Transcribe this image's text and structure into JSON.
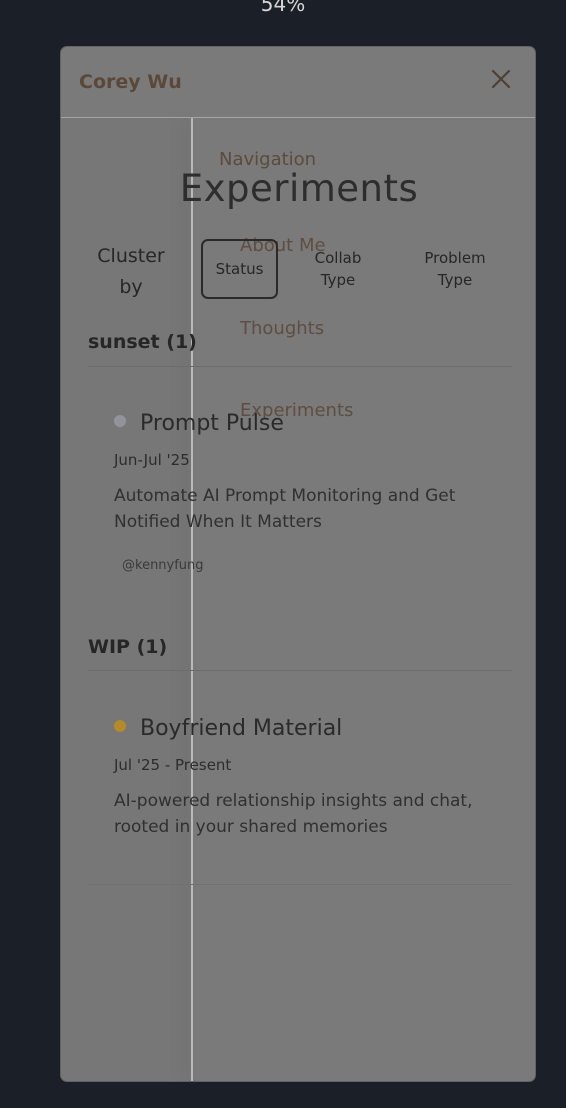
{
  "zoom": "54%",
  "header": {
    "brand": "Corey Wu",
    "close_icon": "close-icon"
  },
  "navigation": {
    "heading": "Navigation",
    "items": [
      "About Me",
      "Thoughts",
      "Experiments"
    ]
  },
  "page": {
    "title": "Experiments"
  },
  "cluster": {
    "label_line1": "Cluster",
    "label_line2": "by",
    "options": [
      {
        "line1": "Status",
        "line2": "",
        "selected": true
      },
      {
        "line1": "Collab",
        "line2": "Type",
        "selected": false
      },
      {
        "line1": "Problem",
        "line2": "Type",
        "selected": false
      }
    ]
  },
  "groups": [
    {
      "title": "sunset (1)",
      "items": [
        {
          "name": "Prompt Pulse",
          "status_color": "#93939b",
          "date": "Jun-Jul '25",
          "desc_line1": "Automate AI Prompt Monitoring and Get",
          "desc_line2": "Notified When It Matters",
          "tag": "@kennyfung"
        }
      ]
    },
    {
      "title": "WIP (1)",
      "items": [
        {
          "name": "Boyfriend Material",
          "status_color": "#b48a2a",
          "date": "Jul '25 - Present",
          "desc_line1": "AI-powered relationship insights and chat,",
          "desc_line2": "rooted in your shared memories"
        }
      ]
    }
  ]
}
